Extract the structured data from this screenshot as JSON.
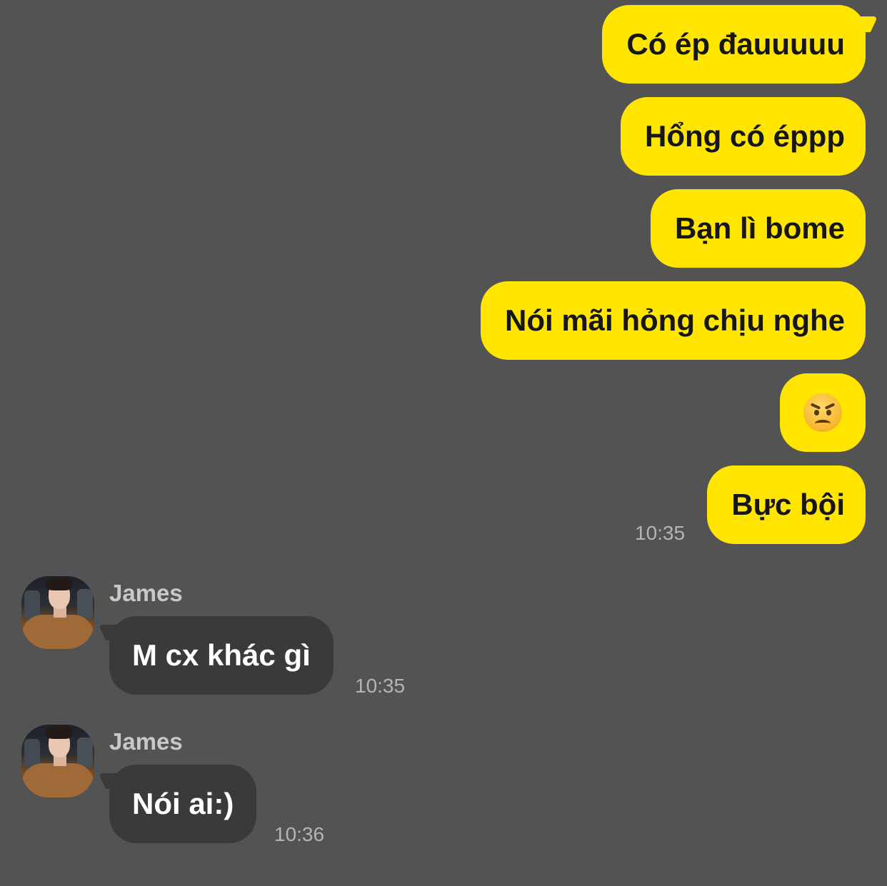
{
  "outgoing_messages": [
    {
      "text": "Có ép đauuuuu"
    },
    {
      "text": "Hổng có éppp"
    },
    {
      "text": "Bạn lì bome"
    },
    {
      "text": "Nói mãi hỏng chịu nghe"
    },
    {
      "text": "",
      "emoji": "angry-face-emoji"
    },
    {
      "text": "Bực bội"
    }
  ],
  "outgoing_timestamp": "10:35",
  "incoming_messages": [
    {
      "sender": "James",
      "text": "M cx khác gì",
      "time": "10:35",
      "avatar": "avatar-photo"
    },
    {
      "sender": "James",
      "text": "Nói ai:)",
      "time": "10:36",
      "avatar": "avatar-photo"
    }
  ],
  "colors": {
    "background": "#545354",
    "outgoing_bubble": "#FFE500",
    "incoming_bubble": "#3A3A3C",
    "timestamp": "#B4B4B4",
    "sender_name": "#C8C8C8"
  }
}
